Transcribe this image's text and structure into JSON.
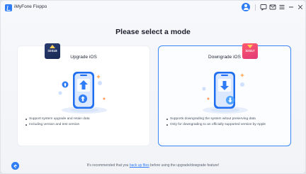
{
  "app": {
    "title": "iMyFone Fixppo"
  },
  "titlebar": {
    "icons": [
      "user-icon",
      "feedback-icon",
      "mail-icon",
      "menu-icon",
      "minimize-icon",
      "close-icon"
    ]
  },
  "heading": "Please select a mode",
  "cards": [
    {
      "id": "upgrade",
      "title": "Upgrade iOS",
      "badge": "iOS18",
      "selected": false,
      "bullets": [
        "Support system upgrade and retain data",
        "Including version and test version"
      ]
    },
    {
      "id": "downgrade",
      "title": "Downgrade iOS",
      "badge": "iOS17",
      "selected": true,
      "bullets": [
        "Supports downgrading the system witout preserving data",
        "Only for downgrading to an officially supported version by Apple"
      ]
    }
  ],
  "footer": {
    "note_prefix": "It's recommended that you ",
    "note_link": "back up files",
    "note_suffix": " before using the upgrade/dowgrade feature!"
  },
  "colors": {
    "accent": "#2f7df6",
    "selected_border": "#3a86f7",
    "badge_upgrade": "#233566",
    "badge_downgrade": "#f04a72"
  }
}
